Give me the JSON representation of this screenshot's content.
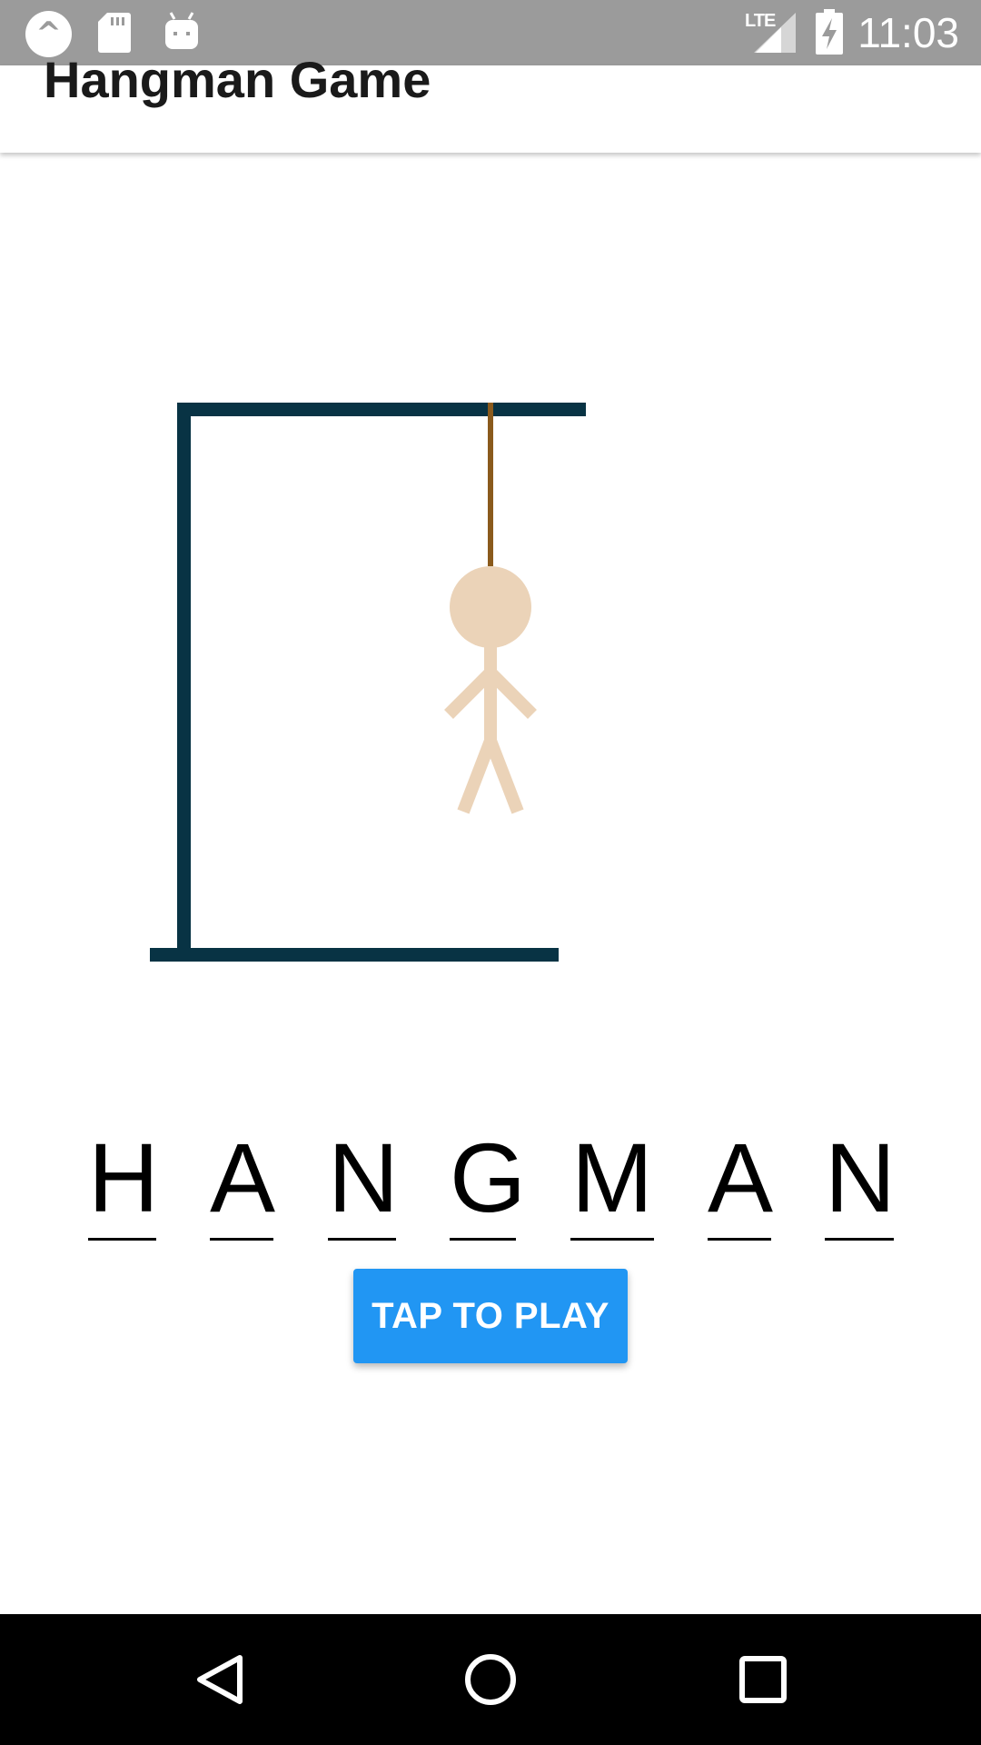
{
  "status_bar": {
    "time": "11:03",
    "network": "LTE",
    "icons": [
      "app-notification-icon",
      "sd-card-icon",
      "android-debug-icon",
      "lte-signal-icon",
      "battery-charging-icon"
    ]
  },
  "app_bar": {
    "title": "Hangman Game"
  },
  "game": {
    "colors": {
      "gallows": "#083344",
      "rope": "#8a5a1c",
      "figure": "#ebd3b8"
    },
    "word_letters": [
      "H",
      "A",
      "N",
      "G",
      "M",
      "A",
      "N"
    ],
    "play_button_label": "TAP TO PLAY"
  },
  "nav_bar": {
    "buttons": [
      "back-icon",
      "home-icon",
      "recents-icon"
    ]
  },
  "colors": {
    "status_bar": "#9b9b9b",
    "accent": "#2196f3",
    "nav_bar": "#000000"
  }
}
